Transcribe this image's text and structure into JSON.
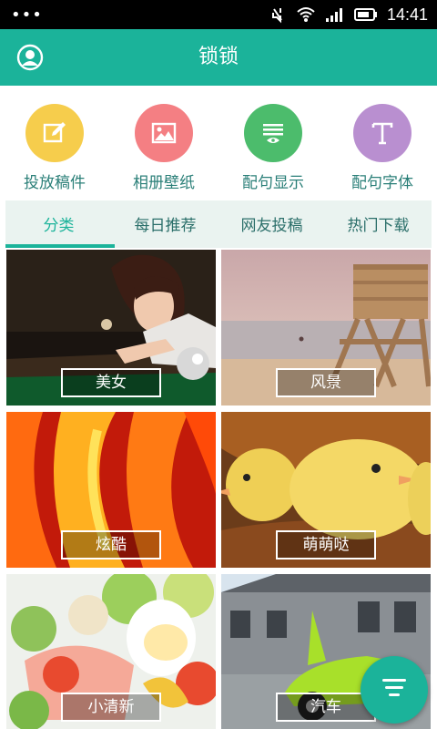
{
  "status_bar": {
    "time": "14:41",
    "dots": "•••",
    "icons": [
      "mute-icon",
      "wifi-icon",
      "signal-icon",
      "battery-icon"
    ]
  },
  "header": {
    "title": "锁锁",
    "avatar_icon": "user-circle-icon"
  },
  "quick_actions": [
    {
      "label": "投放稿件",
      "icon": "edit-icon",
      "color": "#f6cd4c"
    },
    {
      "label": "相册壁纸",
      "icon": "image-icon",
      "color": "#f47f83"
    },
    {
      "label": "配句显示",
      "icon": "list-eye-icon",
      "color": "#4cbc6c"
    },
    {
      "label": "配句字体",
      "icon": "font-t-icon",
      "color": "#b98fd0"
    }
  ],
  "tabs": [
    {
      "label": "分类",
      "active": true
    },
    {
      "label": "每日推荐",
      "active": false
    },
    {
      "label": "网友投稿",
      "active": false
    },
    {
      "label": "热门下载",
      "active": false
    }
  ],
  "categories": [
    {
      "label": "美女"
    },
    {
      "label": "风景"
    },
    {
      "label": "炫酷"
    },
    {
      "label": "萌萌哒"
    },
    {
      "label": "小清新"
    },
    {
      "label": "汽车"
    }
  ],
  "fab": {
    "icon": "menu-lines-icon"
  },
  "colors": {
    "primary": "#1bb39a",
    "tab_bg": "#eaf3f0",
    "label_text": "#2a7f78"
  }
}
